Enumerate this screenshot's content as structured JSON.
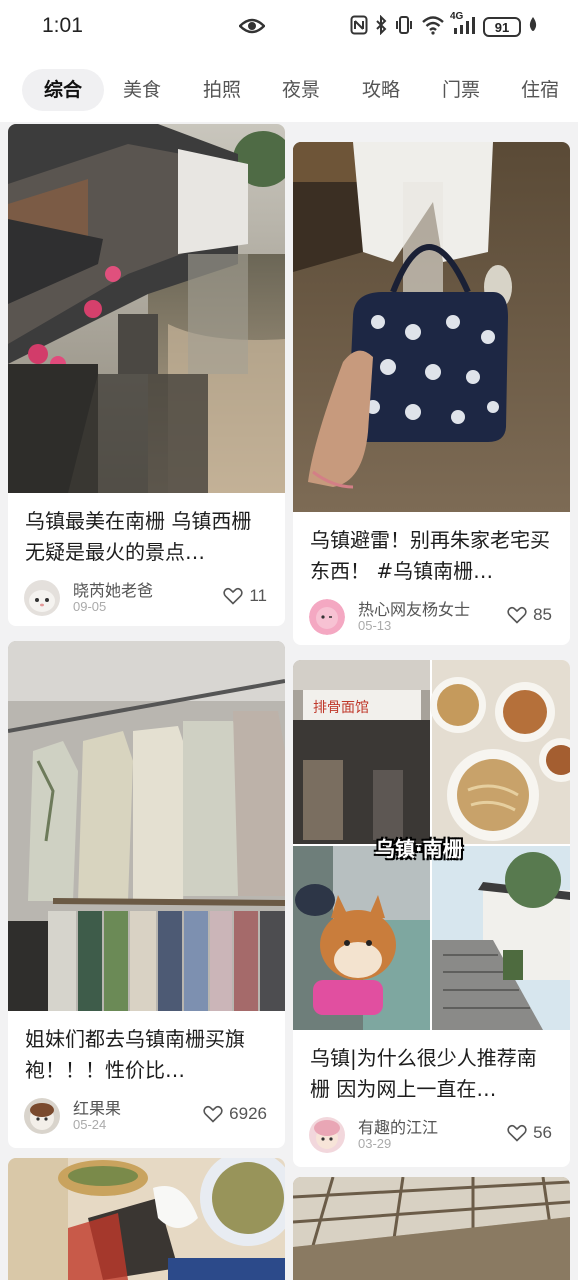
{
  "status_bar": {
    "time": "1:01",
    "battery": "91",
    "network": "4G",
    "icons": [
      "eye-icon",
      "nfc-icon",
      "bluetooth-icon",
      "vibrate-icon",
      "wifi-icon",
      "signal-icon",
      "battery-icon",
      "leaf-icon"
    ]
  },
  "tabs": [
    {
      "label": "综合",
      "active": true
    },
    {
      "label": "美食"
    },
    {
      "label": "拍照"
    },
    {
      "label": "夜景"
    },
    {
      "label": "攻略"
    },
    {
      "label": "门票"
    },
    {
      "label": "住宿"
    }
  ],
  "feed": [
    {
      "title": "乌镇最美在南栅 乌镇西栅无疑是最火的景点…",
      "author": "晓芮她老爸",
      "date": "09-05",
      "likes": "11",
      "image": "canal-water-town-reflection"
    },
    {
      "title": "乌镇避雷！别再朱家老宅买东西！ #乌镇南栅…",
      "author": "热心网友杨女士",
      "date": "05-13",
      "likes": "85",
      "image": "blue-print-handbag"
    },
    {
      "title": "姐妹们都去乌镇南栅买旗袍！！！性价比…",
      "author": "红果果",
      "date": "05-24",
      "likes": "6926",
      "image": "qipao-rack"
    },
    {
      "title": "乌镇|为什么很少人推荐南栅 因为网上一直在…",
      "author": "有趣的江江",
      "date": "03-29",
      "likes": "56",
      "image": "noodle-shop-collage",
      "overlay_text": "乌镇·南栅"
    },
    {
      "title": "",
      "image": "street-food-snacks"
    },
    {
      "title": "",
      "image": "wooden-ceiling"
    }
  ],
  "colors": {
    "background": "#f2f2f3",
    "active_tab_bg": "#f0f0f2",
    "text_primary": "#1d1d1d",
    "text_secondary": "#555555",
    "text_tertiary": "#aaaaaa"
  }
}
